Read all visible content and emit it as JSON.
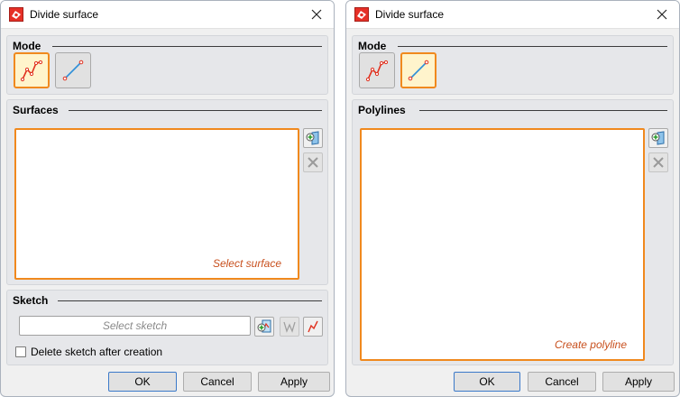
{
  "left_dialog": {
    "title": "Divide surface",
    "mode_section": {
      "title": "Mode",
      "active_mode": "surface"
    },
    "surfaces_section": {
      "title": "Surfaces",
      "hint": "Select surface"
    },
    "sketch_section": {
      "title": "Sketch",
      "placeholder": "Select sketch",
      "delete_checkbox_label": "Delete sketch after creation",
      "delete_checked": false
    },
    "buttons": {
      "ok": "OK",
      "cancel": "Cancel",
      "apply": "Apply"
    }
  },
  "right_dialog": {
    "title": "Divide surface",
    "mode_section": {
      "title": "Mode",
      "active_mode": "polyline"
    },
    "polylines_section": {
      "title": "Polylines",
      "hint": "Create polyline"
    },
    "buttons": {
      "ok": "OK",
      "cancel": "Cancel",
      "apply": "Apply"
    }
  },
  "colors": {
    "accent_orange": "#f0891e",
    "hint_text": "#c8501e",
    "active_fill": "#fff4cc",
    "default_button_border": "#3b79c9"
  },
  "icons": {
    "app": "hicad-app-icon",
    "close": "close-icon",
    "mode_surface": "polyline-surface-icon",
    "mode_polyline": "line-segment-icon",
    "add": "add-selection-icon",
    "remove": "remove-icon",
    "select_sketch": "select-sketch-icon",
    "sketch_tool": "sketch-tool-icon",
    "polyline_tool": "polyline-tool-icon"
  }
}
